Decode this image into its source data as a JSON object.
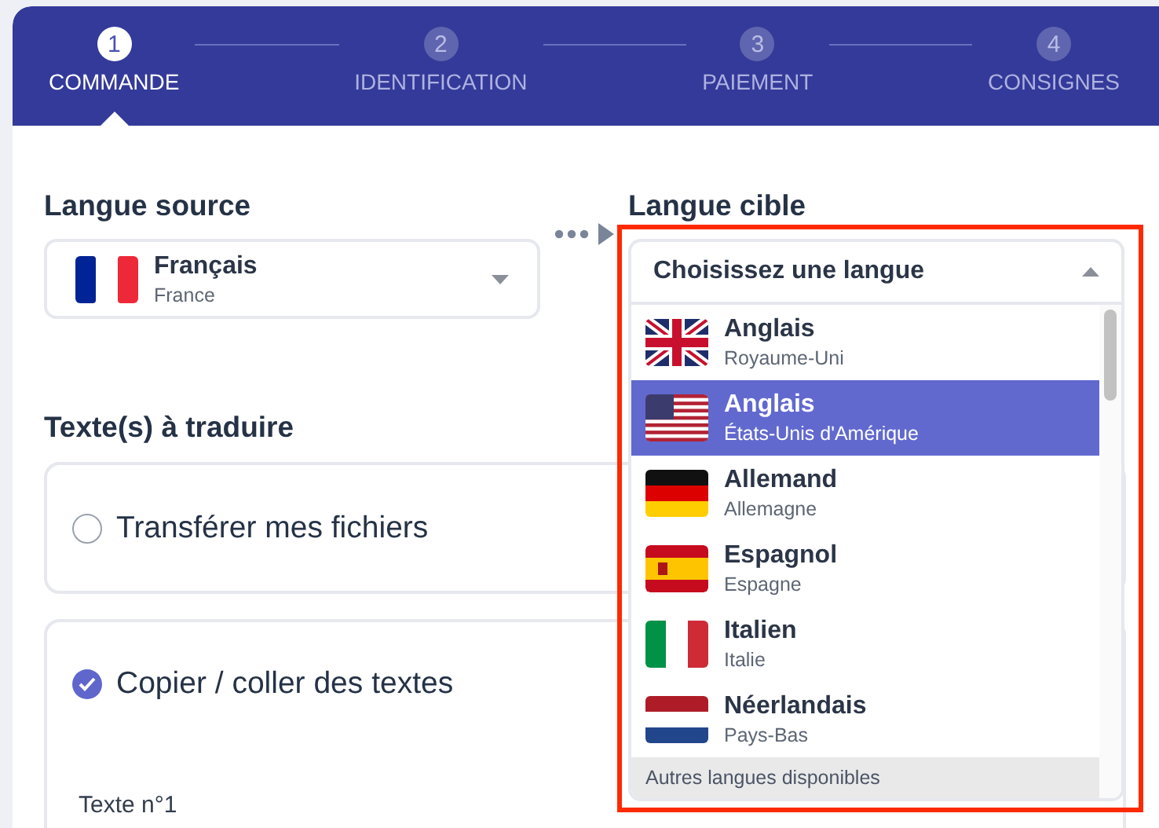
{
  "steps": [
    {
      "number": "1",
      "label": "COMMANDE",
      "selected": true
    },
    {
      "number": "2",
      "label": "IDENTIFICATION",
      "selected": false
    },
    {
      "number": "3",
      "label": "PAIEMENT",
      "selected": false
    },
    {
      "number": "4",
      "label": "CONSIGNES",
      "selected": false
    }
  ],
  "source_language": {
    "heading": "Langue source",
    "name": "Français",
    "region": "France"
  },
  "target_language": {
    "heading": "Langue cible",
    "prompt": "Choisissez une langue",
    "expanded": true,
    "highlighted": true,
    "options": [
      {
        "name": "Anglais",
        "region": "Royaume-Uni",
        "selected": false
      },
      {
        "name": "Anglais",
        "region": "États-Unis d'Amérique",
        "selected": true
      },
      {
        "name": "Allemand",
        "region": "Allemagne",
        "selected": false
      },
      {
        "name": "Espagnol",
        "region": "Espagne",
        "selected": false
      },
      {
        "name": "Italien",
        "region": "Italie",
        "selected": false
      },
      {
        "name": "Néerlandais",
        "region": "Pays-Bas",
        "selected": false
      }
    ],
    "group_header": "Autres langues disponibles"
  },
  "texts_section": {
    "heading": "Texte(s) à traduire",
    "options": [
      {
        "label": "Transférer mes fichiers",
        "selected": false
      },
      {
        "label": "Copier / coller des textes",
        "selected": true
      }
    ],
    "text_label": "Texte n°1"
  }
}
